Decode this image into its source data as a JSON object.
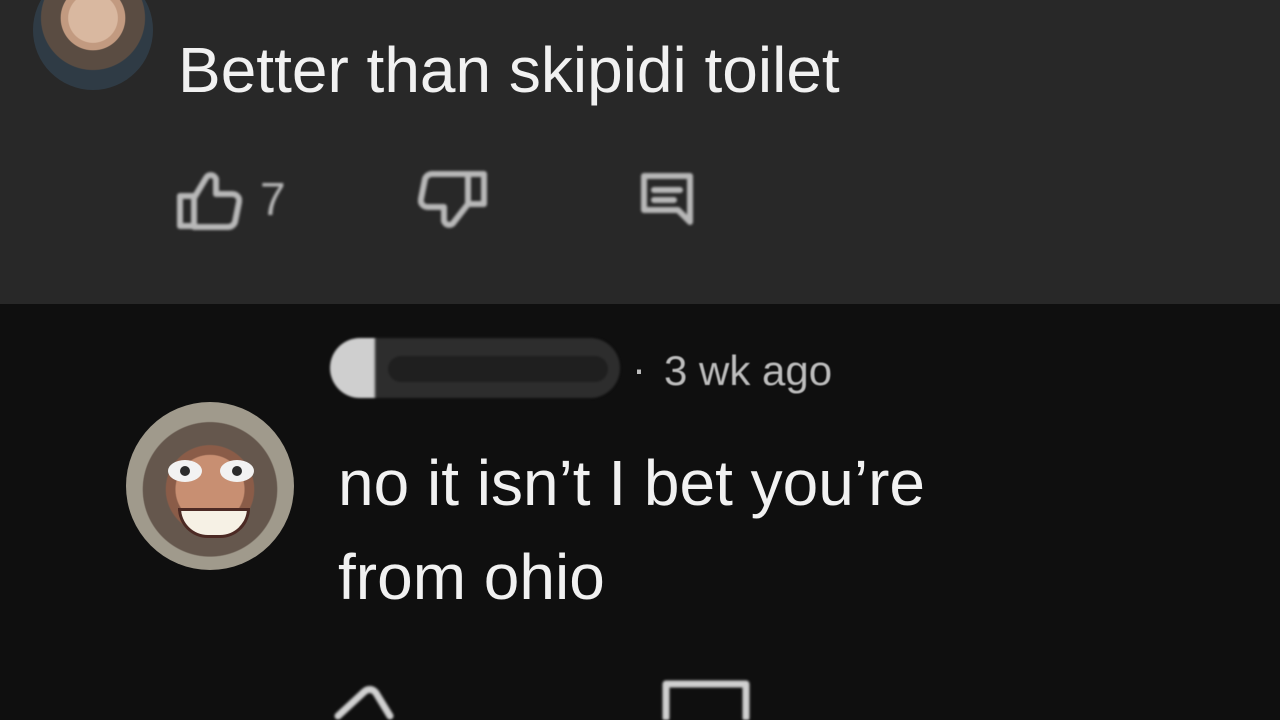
{
  "comments": [
    {
      "text": "Better than skipidi toilet",
      "like_count": "7"
    },
    {
      "time": "3 wk ago",
      "text": "no it isn’t I bet you’re\nfrom ohio"
    }
  ],
  "meta": {
    "separator": "·"
  },
  "icons": {
    "like": "thumb-up-icon",
    "dislike": "thumb-down-icon",
    "reply": "reply-icon"
  },
  "colors": {
    "top_background": "#282828",
    "bottom_background": "#0f0f0f",
    "text": "#f1f1f1",
    "secondary_text": "#bdbdbd"
  }
}
